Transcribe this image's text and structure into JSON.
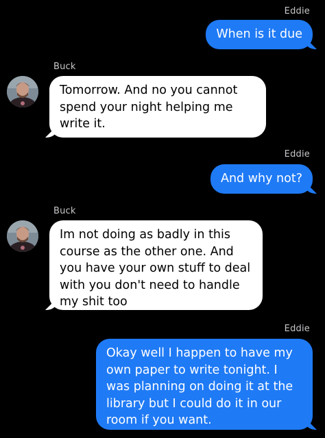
{
  "messages": [
    {
      "sender": "Eddie",
      "direction": "outgoing",
      "text": "When is it due"
    },
    {
      "sender": "Buck",
      "direction": "incoming",
      "text": "Tomorrow. And no you cannot spend your night helping me write it."
    },
    {
      "sender": "Eddie",
      "direction": "outgoing",
      "text": "And why not?"
    },
    {
      "sender": "Buck",
      "direction": "incoming",
      "text": "Im not doing as badly in this course as the other one. And you have your own stuff to deal with you don't need to handle my shit too"
    },
    {
      "sender": "Eddie",
      "direction": "outgoing",
      "text": "Okay well I happen to have my own paper to write tonight. I was planning on doing it at the library but I could do it in our room if you want."
    }
  ],
  "colors": {
    "background": "#000000",
    "outgoing_bubble": "#1f7af5",
    "incoming_bubble": "#ffffff",
    "sender_name": "#c7c7cc"
  },
  "icons": {
    "avatar": "contact-avatar-photo"
  }
}
